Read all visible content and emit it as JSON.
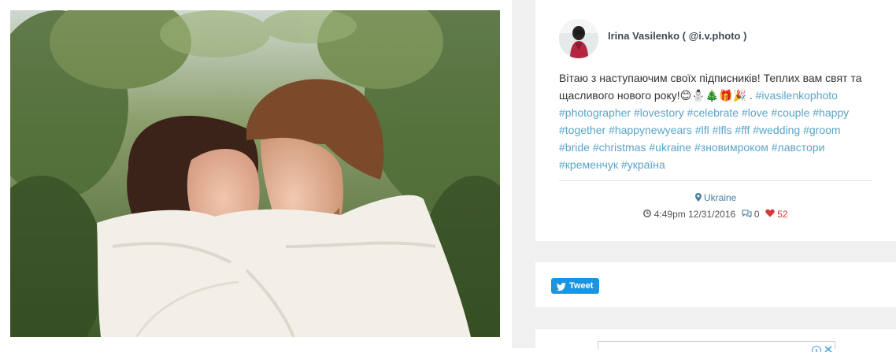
{
  "post": {
    "author": "Irina Vasilenko ( @i.v.photo )",
    "caption_text": "Вітаю з наступаючим своїх підписників! Теплих вам свят та щасливого нового року!😊⛄🎄🎁🎉 .",
    "hashtags": [
      "#ivasilenkophoto",
      "#photographer",
      "#lovestory",
      "#celebrate",
      "#love",
      "#couple",
      "#happy",
      "#together",
      "#happynewyears",
      "#lfl",
      "#lfls",
      "#fff",
      "#wedding",
      "#groom",
      "#bride",
      "#christmas",
      "#ukraine",
      "#зновимроком",
      "#лавстори",
      "#кременчук",
      "#україна"
    ],
    "location": "Ukraine",
    "timestamp": "4:49pm 12/31/2016",
    "comments": "0",
    "likes": "52"
  },
  "share": {
    "tweet_label": "Tweet"
  },
  "icons": {
    "location": "map-marker-icon",
    "time": "clock-icon",
    "comments": "comments-icon",
    "likes": "heart-icon",
    "tweet": "twitter-bird-icon"
  },
  "colors": {
    "hashtag": "#5ba4c8",
    "location": "#4b7fa3",
    "heart": "#d23a3a",
    "tweet_button": "#1b95e0",
    "sidebar_bg": "#f0f0f0"
  }
}
